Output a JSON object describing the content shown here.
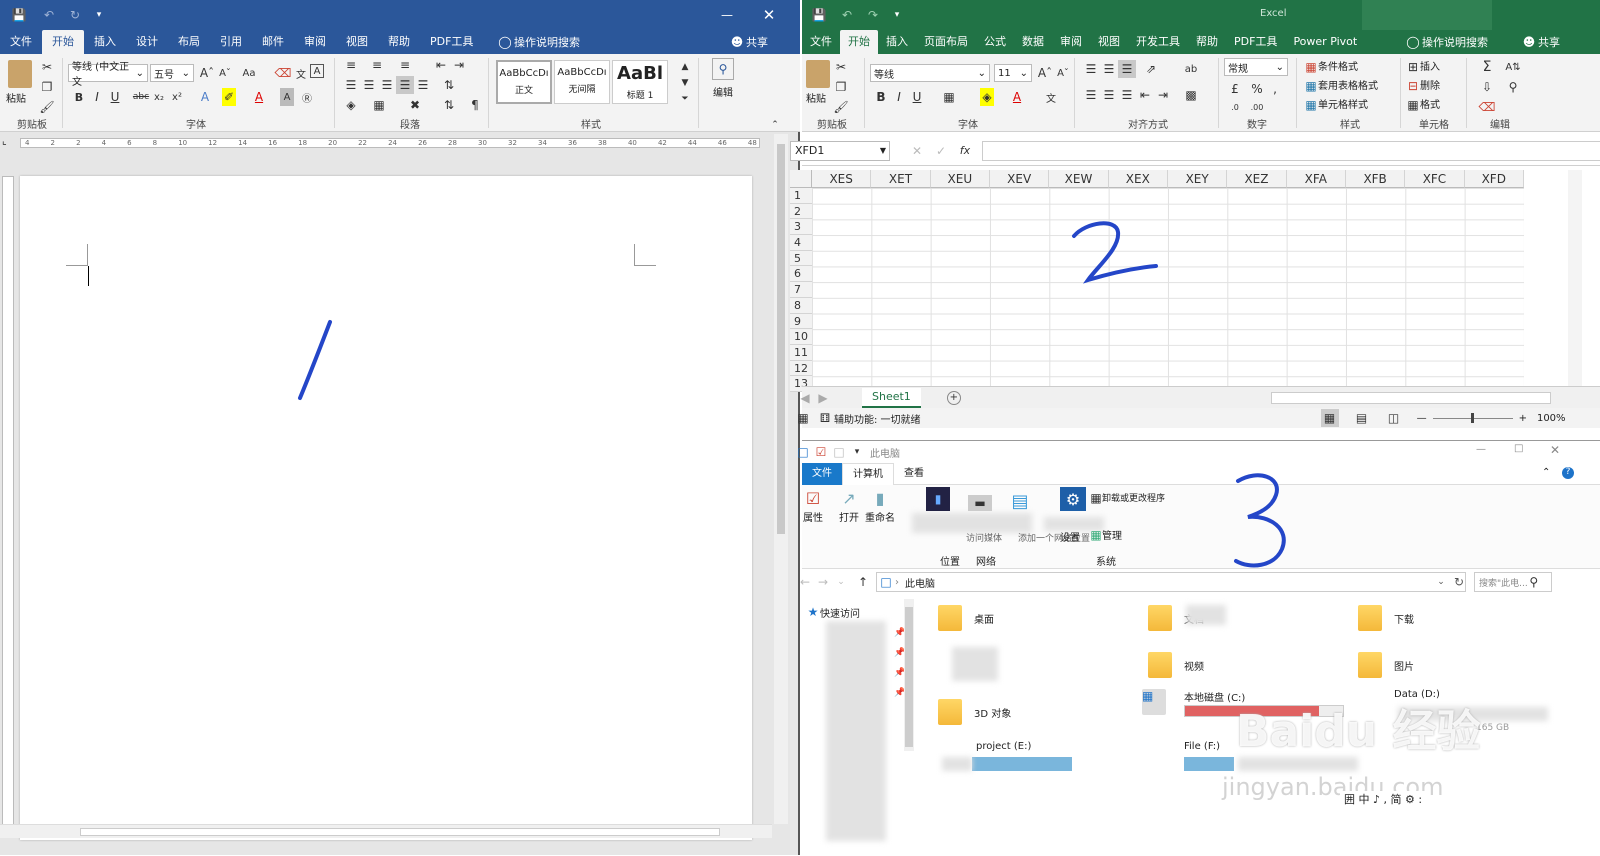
{
  "word": {
    "tabs": [
      "文件",
      "开始",
      "插入",
      "设计",
      "布局",
      "引用",
      "邮件",
      "审阅",
      "视图",
      "帮助",
      "PDF工具"
    ],
    "active_tab": "开始",
    "tell_me": "操作说明搜索",
    "share": "共享",
    "groups": {
      "clipboard": "剪贴板",
      "font": "字体",
      "paragraph": "段落",
      "styles": "样式",
      "edit": "编辑"
    },
    "paste_label": "粘贴",
    "font_name": "等线 (中文正文",
    "font_size": "五号",
    "styles": [
      {
        "preview": "AaBbCcDı",
        "name": "正文"
      },
      {
        "preview": "AaBbCcDı",
        "name": "无间隔"
      },
      {
        "preview": "AaBl",
        "name": "标题 1"
      }
    ],
    "ruler_numbers": [
      "4",
      "2",
      "2",
      "4",
      "6",
      "8",
      "10",
      "12",
      "14",
      "16",
      "18",
      "20",
      "22",
      "24",
      "26",
      "28",
      "30",
      "32",
      "34",
      "36",
      "38",
      "40",
      "42",
      "44",
      "46",
      "48"
    ],
    "annotation": "1"
  },
  "excel": {
    "title": "Excel",
    "tabs": [
      "文件",
      "开始",
      "插入",
      "页面布局",
      "公式",
      "数据",
      "审阅",
      "视图",
      "开发工具",
      "帮助",
      "PDF工具",
      "Power Pivot"
    ],
    "active_tab": "开始",
    "tell_me": "操作说明搜索",
    "share": "共享",
    "paste_label": "粘贴",
    "font_name": "等线",
    "font_size": "11",
    "number_format": "常规",
    "style_items": [
      "条件格式",
      "套用表格格式",
      "单元格样式"
    ],
    "cell_items": [
      "插入",
      "删除",
      "格式"
    ],
    "groups": {
      "clipboard": "剪贴板",
      "font": "字体",
      "align": "对齐方式",
      "number": "数字",
      "styles": "样式",
      "cells": "单元格",
      "edit": "编辑"
    },
    "name_box": "XFD1",
    "fx": "fx",
    "columns": [
      "XES",
      "XET",
      "XEU",
      "XEV",
      "XEW",
      "XEX",
      "XEY",
      "XEZ",
      "XFA",
      "XFB",
      "XFC",
      "XFD"
    ],
    "rows": [
      "1",
      "2",
      "3",
      "4",
      "5",
      "6",
      "7",
      "8",
      "9",
      "10",
      "11",
      "12",
      "13"
    ],
    "sheet_tab": "Sheet1",
    "status": "辅助功能: 一切就绪",
    "zoom": "100%",
    "annotation": "2"
  },
  "explorer": {
    "title": "此电脑",
    "tabs": [
      "文件",
      "计算机",
      "查看"
    ],
    "active_tab": "计算机",
    "ribbon_items": [
      "属性",
      "打开",
      "重命名"
    ],
    "network_items": [
      "访问媒体",
      "映射网络驱动器",
      "添加一个网络位置"
    ],
    "system_items": [
      "卸载或更改程序",
      "设置",
      "管理"
    ],
    "groups": {
      "location": "位置",
      "network": "网络",
      "system": "系统"
    },
    "address": "此电脑",
    "search_placeholder": "搜索\"此电...",
    "quick_access": "快速访问",
    "folders": [
      {
        "name": "桌面",
        "col": 0,
        "row": 0
      },
      {
        "name": "文档",
        "col": 1,
        "row": 0
      },
      {
        "name": "下载",
        "col": 2,
        "row": 0
      },
      {
        "name": "视频",
        "col": 1,
        "row": 1
      },
      {
        "name": "图片",
        "col": 2,
        "row": 1
      },
      {
        "name": "3D 对象",
        "col": 0,
        "row": 2
      }
    ],
    "drives": [
      {
        "name": "本地磁盘 (C:)",
        "fill": 0.85
      },
      {
        "name": "Data (D:)",
        "size": "165 GB"
      },
      {
        "name": "project (E:)"
      },
      {
        "name": "File (F:)"
      }
    ],
    "annotation": "3",
    "ime_bar": "囲 中 ♪ , 简 ⚙ :"
  },
  "watermark": {
    "brand": "Baidu 经验",
    "url": "jingyan.baidu.com"
  },
  "colors": {
    "word_blue": "#2b579a",
    "excel_green": "#217346",
    "pen_blue": "#2446c8"
  }
}
